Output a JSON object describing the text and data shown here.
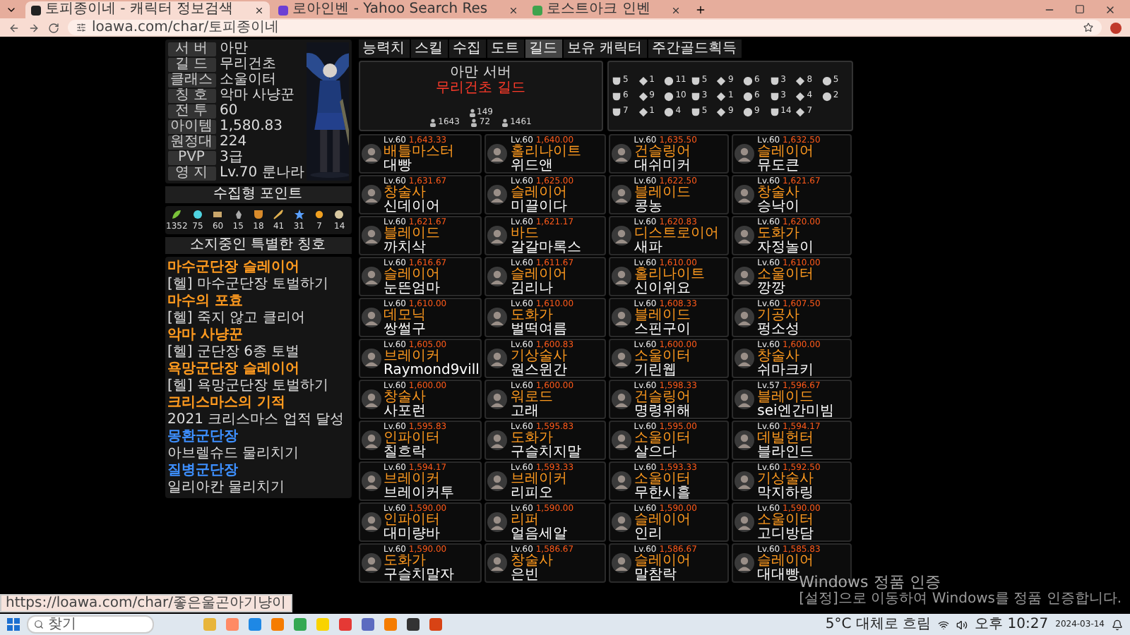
{
  "browser": {
    "tabs": [
      {
        "title": "토피종이네 - 캐릭터 정보검색",
        "selected": true
      },
      {
        "title": "로아인벤 - Yahoo Search Res",
        "selected": false
      },
      {
        "title": "로스트아크 인벤",
        "selected": false
      }
    ],
    "address": "loawa.com/char/토피종이네"
  },
  "profile": {
    "info": [
      {
        "label": "서 버",
        "value": "아만"
      },
      {
        "label": "길 드",
        "value": "무리건초"
      },
      {
        "label": "클래스",
        "value": "소울이터"
      },
      {
        "label": "칭 호",
        "value": "악마 사냥꾼"
      },
      {
        "label": "전 투",
        "value": "60"
      },
      {
        "label": "아이템",
        "value": "1,580.83"
      },
      {
        "label": "원정대",
        "value": "224"
      },
      {
        "label": "PVP",
        "value": "3급"
      },
      {
        "label": "영 지",
        "value": "Lv.70 룬나라"
      }
    ],
    "points_title": "수집형 포인트",
    "points": [
      "1352",
      "75",
      "60",
      "15",
      "18",
      "41",
      "31",
      "7",
      "14"
    ],
    "titles_heading": "소지중인 특별한 칭호",
    "titles": [
      {
        "title": "마수군단장 슬레이어",
        "color": "#ff9a1f",
        "desc": "[헬] 마수군단장 토벌하기"
      },
      {
        "title": "마수의 포효",
        "color": "#ff9a1f",
        "desc": "[헬] 죽지 않고 클리어"
      },
      {
        "title": "악마 사냥꾼",
        "color": "#ff9a1f",
        "desc": "[헬] 군단장 6종 토벌"
      },
      {
        "title": "욕망군단장 슬레이어",
        "color": "#ff9a1f",
        "desc": "[헬] 욕망군단장 토벌하기"
      },
      {
        "title": "크리스마스의 기적",
        "color": "#ff9a1f",
        "desc": "2021 크리스마스 업적 달성"
      },
      {
        "title": "몽환군단장",
        "color": "#3d8fff",
        "desc": "아브렐슈드 물리치기"
      },
      {
        "title": "질병군단장",
        "color": "#3d8fff",
        "desc": "일리아칸 물리치기"
      }
    ]
  },
  "main": {
    "tabs": [
      {
        "label": "능력치",
        "selected": false
      },
      {
        "label": "스킬",
        "selected": false
      },
      {
        "label": "수집",
        "selected": false
      },
      {
        "label": "도트",
        "selected": false
      },
      {
        "label": "길드",
        "selected": true
      },
      {
        "label": "보유 캐릭터",
        "selected": false
      },
      {
        "label": "주간골드획득",
        "selected": false
      }
    ],
    "guild": {
      "server": "아만 서버",
      "name": "무리건초 길드",
      "members": "149",
      "stats": [
        "1643",
        "72",
        "1461"
      ]
    },
    "emblems": [
      "5",
      "1",
      "11",
      "5",
      "9",
      "6",
      "3",
      "8",
      "5",
      "6",
      "9",
      "10",
      "3",
      "1",
      "6",
      "3",
      "4",
      "2",
      "7",
      "1",
      "4",
      "5",
      "9",
      "9",
      "14",
      "7"
    ],
    "members": [
      {
        "level": "Lv.60",
        "item": "1,643.33",
        "class": "배틀마스터",
        "name": "대빵"
      },
      {
        "level": "Lv.60",
        "item": "1,640.00",
        "class": "홀리나이트",
        "name": "위드앤"
      },
      {
        "level": "Lv.60",
        "item": "1,635.50",
        "class": "건슬링어",
        "name": "대쉬미커"
      },
      {
        "level": "Lv.60",
        "item": "1,632.50",
        "class": "슬레이어",
        "name": "뮤도큰"
      },
      {
        "level": "Lv.60",
        "item": "1,631.67",
        "class": "창술사",
        "name": "신데이어"
      },
      {
        "level": "Lv.60",
        "item": "1,625.00",
        "class": "슬레이어",
        "name": "미끌이다"
      },
      {
        "level": "Lv.60",
        "item": "1,622.50",
        "class": "블레이드",
        "name": "콩농"
      },
      {
        "level": "Lv.60",
        "item": "1,621.67",
        "class": "창술사",
        "name": "승낙이"
      },
      {
        "level": "Lv.60",
        "item": "1,621.67",
        "class": "블레이드",
        "name": "까치삭"
      },
      {
        "level": "Lv.60",
        "item": "1,621.17",
        "class": "바드",
        "name": "갈갈마록스"
      },
      {
        "level": "Lv.60",
        "item": "1,620.83",
        "class": "디스트로이어",
        "name": "새파"
      },
      {
        "level": "Lv.60",
        "item": "1,620.00",
        "class": "도화가",
        "name": "자정놀이"
      },
      {
        "level": "Lv.60",
        "item": "1,616.67",
        "class": "슬레이어",
        "name": "눈뜬엄마"
      },
      {
        "level": "Lv.60",
        "item": "1,611.67",
        "class": "슬레이어",
        "name": "김리나"
      },
      {
        "level": "Lv.60",
        "item": "1,610.00",
        "class": "홀리나이트",
        "name": "신이위요"
      },
      {
        "level": "Lv.60",
        "item": "1,610.00",
        "class": "소울이터",
        "name": "깡깡"
      },
      {
        "level": "Lv.60",
        "item": "1,610.00",
        "class": "데모닉",
        "name": "쌍썰구"
      },
      {
        "level": "Lv.60",
        "item": "1,610.00",
        "class": "도화가",
        "name": "벌떡여름"
      },
      {
        "level": "Lv.60",
        "item": "1,608.33",
        "class": "블레이드",
        "name": "스핀구이"
      },
      {
        "level": "Lv.60",
        "item": "1,607.50",
        "class": "기공사",
        "name": "펑소성"
      },
      {
        "level": "Lv.60",
        "item": "1,605.00",
        "class": "브레이커",
        "name": "Raymond9vill"
      },
      {
        "level": "Lv.60",
        "item": "1,600.83",
        "class": "기상술사",
        "name": "원스윈간"
      },
      {
        "level": "Lv.60",
        "item": "1,600.00",
        "class": "소울이터",
        "name": "기린웹"
      },
      {
        "level": "Lv.60",
        "item": "1,600.00",
        "class": "창술사",
        "name": "쉬마크키"
      },
      {
        "level": "Lv.60",
        "item": "1,600.00",
        "class": "창술사",
        "name": "사포런"
      },
      {
        "level": "Lv.60",
        "item": "1,600.00",
        "class": "워로드",
        "name": "고래"
      },
      {
        "level": "Lv.60",
        "item": "1,598.33",
        "class": "건슬링어",
        "name": "명령위해"
      },
      {
        "level": "Lv.57",
        "item": "1,596.67",
        "class": "블레이드",
        "name": "sei엔간미빔"
      },
      {
        "level": "Lv.60",
        "item": "1,595.83",
        "class": "인파이터",
        "name": "칠흐락"
      },
      {
        "level": "Lv.60",
        "item": "1,595.83",
        "class": "도화가",
        "name": "구슬치지말"
      },
      {
        "level": "Lv.60",
        "item": "1,595.00",
        "class": "소울이터",
        "name": "살으다"
      },
      {
        "level": "Lv.60",
        "item": "1,594.17",
        "class": "데빌헌터",
        "name": "블라인드"
      },
      {
        "level": "Lv.60",
        "item": "1,594.17",
        "class": "브레이커",
        "name": "브레이커투"
      },
      {
        "level": "Lv.60",
        "item": "1,593.33",
        "class": "브레이커",
        "name": "리피오"
      },
      {
        "level": "Lv.60",
        "item": "1,593.33",
        "class": "소울이터",
        "name": "무한시흘"
      },
      {
        "level": "Lv.60",
        "item": "1,592.50",
        "class": "기상술사",
        "name": "막지하링"
      },
      {
        "level": "Lv.60",
        "item": "1,590.00",
        "class": "인파이터",
        "name": "대미량바"
      },
      {
        "level": "Lv.60",
        "item": "1,590.00",
        "class": "리퍼",
        "name": "얼음세알"
      },
      {
        "level": "Lv.60",
        "item": "1,590.00",
        "class": "슬레이어",
        "name": "인리"
      },
      {
        "level": "Lv.60",
        "item": "1,590.00",
        "class": "소울이터",
        "name": "고디방담"
      },
      {
        "level": "Lv.60",
        "item": "1,590.00",
        "class": "도화가",
        "name": "구슬치말자"
      },
      {
        "level": "Lv.60",
        "item": "1,586.67",
        "class": "창술사",
        "name": "은빈"
      },
      {
        "level": "Lv.60",
        "item": "1,586.67",
        "class": "슬레이어",
        "name": "말참락"
      },
      {
        "level": "Lv.60",
        "item": "1,585.83",
        "class": "슬레이어",
        "name": "대대빵"
      }
    ]
  },
  "status_link": "https://loawa.com/char/좋은울곤아기냥이",
  "activation": {
    "title": "Windows 정품 인증",
    "text": "[설정]으로 이동하여 Windows를 정품 인증합니다."
  },
  "taskbar": {
    "search": "찾기",
    "weather": "5°C 대체로 흐림",
    "time": "오후 10:27",
    "date": "2024-03-14"
  }
}
